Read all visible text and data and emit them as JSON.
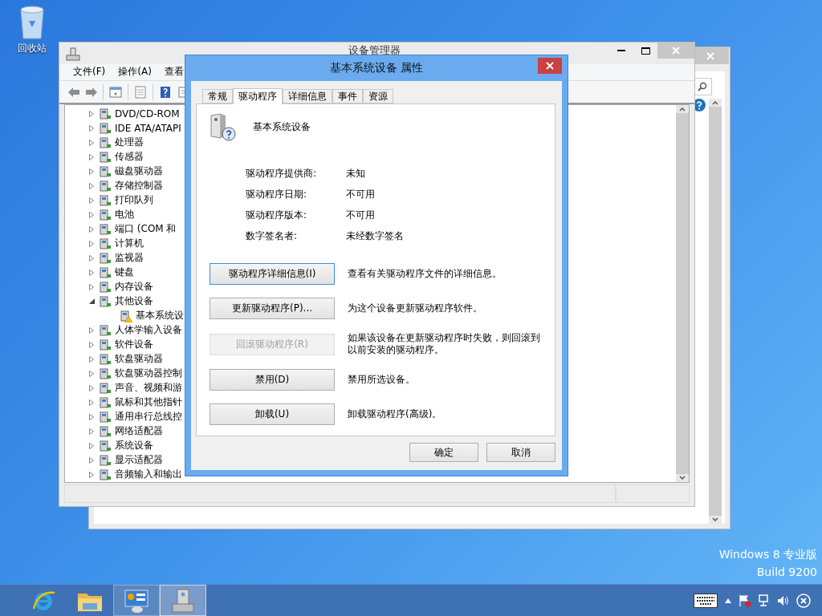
{
  "desktop": {
    "icons": [
      {
        "label": "回收站"
      }
    ],
    "edition": [
      "Windows 8 专业版",
      "Build 9200"
    ]
  },
  "device_manager": {
    "title": "设备管理器",
    "menu": [
      "文件(F)",
      "操作(A)",
      "查看"
    ],
    "tree": [
      {
        "label": "DVD/CD-ROM",
        "expanded": false
      },
      {
        "label": "IDE ATA/ATAPI",
        "expanded": false
      },
      {
        "label": "处理器",
        "expanded": false
      },
      {
        "label": "传感器",
        "expanded": false
      },
      {
        "label": "磁盘驱动器",
        "expanded": false
      },
      {
        "label": "存储控制器",
        "expanded": false
      },
      {
        "label": "打印队列",
        "expanded": false
      },
      {
        "label": "电池",
        "expanded": false
      },
      {
        "label": "端口 (COM 和",
        "expanded": false
      },
      {
        "label": "计算机",
        "expanded": false
      },
      {
        "label": "监视器",
        "expanded": false
      },
      {
        "label": "键盘",
        "expanded": false
      },
      {
        "label": "内存设备",
        "expanded": false
      },
      {
        "label": "其他设备",
        "expanded": true,
        "children": [
          {
            "label": "基本系统设",
            "warning": true
          }
        ]
      },
      {
        "label": "人体学输入设备",
        "expanded": false
      },
      {
        "label": "软件设备",
        "expanded": false
      },
      {
        "label": "软盘驱动器",
        "expanded": false
      },
      {
        "label": "软盘驱动器控制",
        "expanded": false
      },
      {
        "label": "声音、视频和游",
        "expanded": false
      },
      {
        "label": "鼠标和其他指针",
        "expanded": false
      },
      {
        "label": "通用串行总线控",
        "expanded": false
      },
      {
        "label": "网络适配器",
        "expanded": false
      },
      {
        "label": "系统设备",
        "expanded": false
      },
      {
        "label": "显示适配器",
        "expanded": false
      },
      {
        "label": "音频输入和输出",
        "expanded": false
      }
    ]
  },
  "dialog": {
    "title": "基本系统设备 属性",
    "tabs": [
      {
        "label": "常规",
        "selected": false
      },
      {
        "label": "驱动程序",
        "selected": true
      },
      {
        "label": "详细信息",
        "selected": false
      },
      {
        "label": "事件",
        "selected": false
      },
      {
        "label": "资源",
        "selected": false
      }
    ],
    "device_name": "基本系统设备",
    "properties": [
      {
        "label": "驱动程序提供商:",
        "value": "未知"
      },
      {
        "label": "驱动程序日期:",
        "value": "不可用"
      },
      {
        "label": "驱动程序版本:",
        "value": "不可用"
      },
      {
        "label": "数字签名者:",
        "value": "未经数字签名"
      }
    ],
    "actions": [
      {
        "button": "驱动程序详细信息(I)",
        "description": "查看有关驱动程序文件的详细信息。",
        "disabled": false,
        "focused": true
      },
      {
        "button": "更新驱动程序(P)...",
        "description": "为这个设备更新驱动程序软件。",
        "disabled": false,
        "focused": false
      },
      {
        "button": "回滚驱动程序(R)",
        "description": "如果该设备在更新驱动程序时失败，则回滚到以前安装的驱动程序。",
        "disabled": true,
        "focused": false
      },
      {
        "button": "禁用(D)",
        "description": "禁用所选设备。",
        "disabled": false,
        "focused": false
      },
      {
        "button": "卸载(U)",
        "description": "卸载驱动程序(高级)。",
        "disabled": false,
        "focused": false
      }
    ],
    "buttons": [
      "确定",
      "取消"
    ]
  },
  "taskbar": {
    "apps": [
      {
        "kind": "browser",
        "selected": false,
        "open": false
      },
      {
        "kind": "folder",
        "selected": false,
        "open": false
      },
      {
        "kind": "control-panel",
        "selected": false,
        "open": true
      },
      {
        "kind": "device-manager",
        "selected": true,
        "open": true
      }
    ]
  }
}
